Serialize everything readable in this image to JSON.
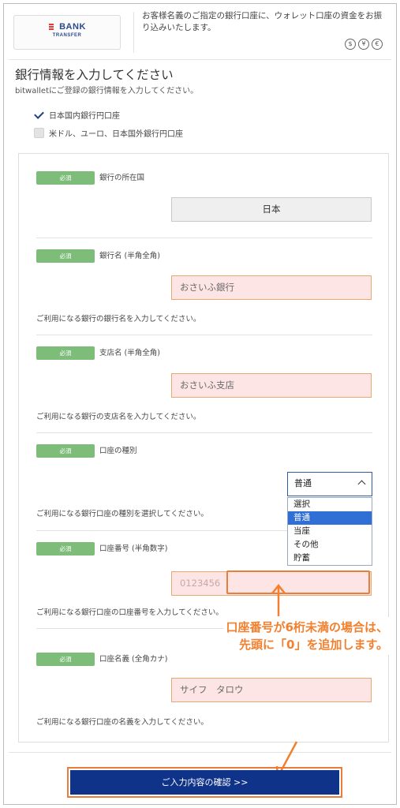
{
  "header": {
    "logo_main": "BANK",
    "logo_sub": "TRANSFER",
    "description": "お客様名義のご指定の銀行口座に、ウォレット口座の資金をお振り込みいたします。",
    "currency_icons": [
      "$",
      "¥",
      "€"
    ]
  },
  "section": {
    "title": "銀行情報を入力してください",
    "subtitle": "bitwalletにご登録の銀行情報を入力してください。"
  },
  "bank_type": {
    "domestic_label": "日本国内銀行円口座",
    "domestic_checked": true,
    "foreign_label": "米ドル、ユーロ、日本国外銀行円口座",
    "foreign_checked": false
  },
  "required_badge": "必須",
  "fields": {
    "country": {
      "label": "銀行の所在国",
      "value": "日本"
    },
    "bank_name": {
      "label": "銀行名 (半角全角)",
      "value": "おさいふ銀行",
      "help": "ご利用になる銀行の銀行名を入力してください。"
    },
    "branch_name": {
      "label": "支店名 (半角全角)",
      "value": "おさいふ支店",
      "help": "ご利用になる銀行の支店名を入力してください。"
    },
    "account_type": {
      "label": "口座の種別",
      "selected": "普通",
      "options": [
        "選択",
        "普通",
        "当座",
        "その他",
        "貯蓄"
      ],
      "help": "ご利用になる銀行口座の種別を選択してください。"
    },
    "account_number": {
      "label": "口座番号 (半角数字)",
      "value": "0123456",
      "help": "ご利用になる銀行口座の口座番号を入力してください。"
    },
    "account_holder": {
      "label": "口座名義 (全角カナ)",
      "value": "サイフ　タロウ",
      "help": "ご利用になる銀行口座の名義を入力してください。"
    }
  },
  "annotation": {
    "line1": "口座番号が6桁未満の場合は、",
    "line2": "先頭に「0」を追加します。",
    "color": "#f2802f"
  },
  "confirm_button": "ご入力内容の確認 >>",
  "colors": {
    "primary": "#0f3389",
    "required": "#7dbd79",
    "input_bg": "#fde5e5",
    "highlight": "#e97d3a"
  }
}
